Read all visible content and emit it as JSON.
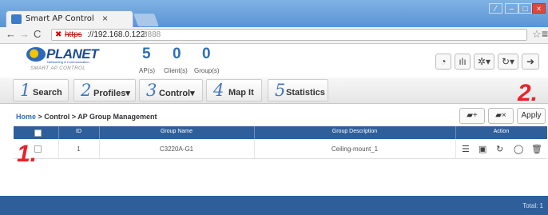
{
  "browser": {
    "tab_title": "Smart AP Control",
    "tab_close": "×",
    "url_scheme": "https",
    "url_host": "://192.168.0.122:",
    "url_port": "8888",
    "win_controls": [
      "⁄",
      "–",
      "□",
      "×"
    ]
  },
  "app": {
    "logo": "PLANET",
    "logo_sub": "Networking & Communication",
    "tagline": "SMART AP CONTROL",
    "counters": [
      {
        "value": "5",
        "label": "AP(s)"
      },
      {
        "value": "0",
        "label": "Client(s)"
      },
      {
        "value": "0",
        "label": "Group(s)"
      }
    ]
  },
  "nav": {
    "items": [
      {
        "num": "1",
        "label": "Search"
      },
      {
        "num": "2",
        "label": "Profiles▾"
      },
      {
        "num": "3",
        "label": "Control▾"
      },
      {
        "num": "4",
        "label": "Map It"
      },
      {
        "num": "5",
        "label": "Statistics"
      }
    ]
  },
  "breadcrumb": {
    "home": "Home",
    "rest": " > Control > AP Group Management"
  },
  "actions": {
    "apply": "Apply"
  },
  "table": {
    "headers": [
      "ID",
      "Group Name",
      "Group Description",
      "Action"
    ],
    "rows": [
      {
        "id": "1",
        "name": "C3220A-G1",
        "description": "Ceiling-mount_1"
      }
    ]
  },
  "footer": {
    "total": "Total: 1"
  },
  "annotations": {
    "one": "1.",
    "two": "2."
  },
  "colors": {
    "header_blue": "#2f5f9a",
    "annotation_red": "#e9222a",
    "counter_blue": "#2e6fb8"
  }
}
